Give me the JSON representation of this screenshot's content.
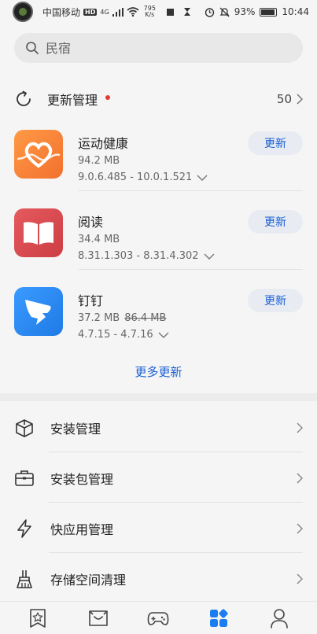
{
  "status_bar": {
    "carrier": "中国移动",
    "hd": "HD",
    "network": "4G",
    "speed_value": "795",
    "speed_unit": "K/s",
    "battery": "93%",
    "time": "10:44"
  },
  "search": {
    "placeholder": "民宿"
  },
  "update_section": {
    "title": "更新管理",
    "count": "50",
    "apps": [
      {
        "name": "运动健康",
        "size": "94.2 MB",
        "old_size": "",
        "version": "9.0.6.485 - 10.0.1.521",
        "button": "更新",
        "icon_color": "#f7803a"
      },
      {
        "name": "阅读",
        "size": "34.4 MB",
        "old_size": "",
        "version": "8.31.1.303 - 8.31.4.302",
        "button": "更新",
        "icon_color": "#dc4a4f"
      },
      {
        "name": "钉钉",
        "size": "37.2 MB",
        "old_size": "86.4 MB",
        "version": "4.7.15 - 4.7.16",
        "button": "更新",
        "icon_color": "#2c8bf2"
      }
    ],
    "more_label": "更多更新"
  },
  "menu": [
    {
      "label": "安装管理",
      "icon": "box-icon"
    },
    {
      "label": "安装包管理",
      "icon": "briefcase-icon"
    },
    {
      "label": "快应用管理",
      "icon": "lightning-icon"
    },
    {
      "label": "存储空间清理",
      "icon": "broom-icon"
    }
  ],
  "bottom_nav": [
    {
      "icon": "star-icon",
      "active": false
    },
    {
      "icon": "app-store-icon",
      "active": false
    },
    {
      "icon": "gamepad-icon",
      "active": false
    },
    {
      "icon": "manage-icon",
      "active": true
    },
    {
      "icon": "person-icon",
      "active": false
    }
  ],
  "colors": {
    "accent": "#1a5fd4",
    "badge": "#e53935",
    "active_nav": "#1a7ef0"
  }
}
